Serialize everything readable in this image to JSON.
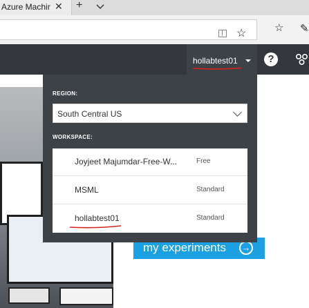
{
  "browser": {
    "tab_title": "Azure Machir",
    "tab_close": "✕",
    "tab_new": "+",
    "icons": [
      "reading-view-icon",
      "favorite-star-icon",
      "favorites-hub-icon",
      "pen-icon"
    ]
  },
  "header": {
    "user_name": "hollabtest01",
    "help_glyph": "?",
    "icons": [
      "caret-down-icon",
      "help-icon",
      "people-icon"
    ]
  },
  "dropdown": {
    "region_label": "REGION:",
    "region_value": "South Central US",
    "workspace_label": "WORKSPACE:",
    "workspaces": [
      {
        "name": "Joyjeet Majumdar-Free-W...",
        "tier": "Free"
      },
      {
        "name": "MSML",
        "tier": "Standard"
      },
      {
        "name": "hollabtest01",
        "tier": "Standard"
      }
    ]
  },
  "main": {
    "cta_label": "my experiments",
    "cta_arrow": "→"
  },
  "colors": {
    "header_bg": "#33373c",
    "panel_bg": "#3d4247",
    "accent": "#1ba1e2",
    "annotation_red": "#d9241e"
  }
}
